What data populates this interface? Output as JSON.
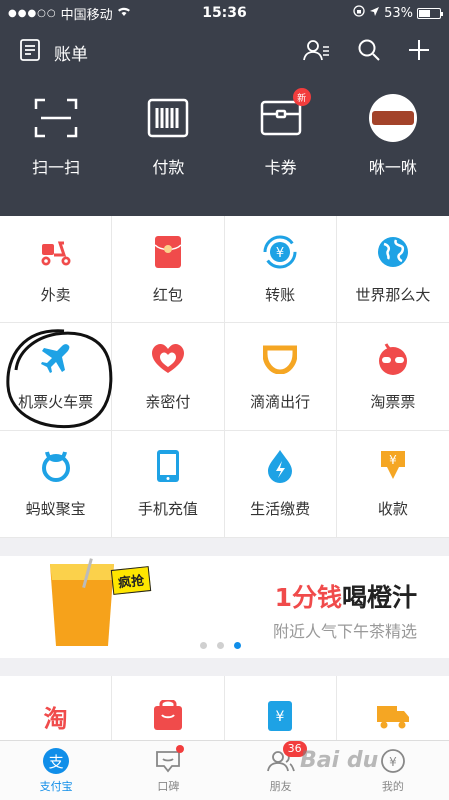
{
  "status_bar": {
    "carrier": "中国移动",
    "time": "15:36",
    "battery": "53%",
    "battery_level": 0.53
  },
  "navbar": {
    "title": "账单"
  },
  "quick_actions": [
    {
      "label": "扫一扫",
      "icon": "scan-icon"
    },
    {
      "label": "付款",
      "icon": "barcode-pay-icon"
    },
    {
      "label": "卡券",
      "icon": "wallet-card-icon",
      "badge": "新"
    },
    {
      "label": "咻一咻",
      "icon": "xiu-avatar-icon"
    }
  ],
  "services": [
    {
      "label": "外卖",
      "icon": "scooter-icon",
      "color": "#f04b4b"
    },
    {
      "label": "红包",
      "icon": "red-envelope-icon",
      "color": "#f04b4b"
    },
    {
      "label": "转账",
      "icon": "transfer-yen-icon",
      "color": "#1ea2e5"
    },
    {
      "label": "世界那么大",
      "icon": "globe-icon",
      "color": "#1ea2e5"
    },
    {
      "label": "机票火车票",
      "icon": "airplane-icon",
      "color": "#1ea2e5"
    },
    {
      "label": "亲密付",
      "icon": "hearts-icon",
      "color": "#f04b4b"
    },
    {
      "label": "滴滴出行",
      "icon": "didi-icon",
      "color": "#f5a623"
    },
    {
      "label": "淘票票",
      "icon": "taopiaopiao-icon",
      "color": "#f04b4b"
    },
    {
      "label": "蚂蚁聚宝",
      "icon": "ant-treasure-icon",
      "color": "#1ea2e5"
    },
    {
      "label": "手机充值",
      "icon": "phone-icon",
      "color": "#1ea2e5"
    },
    {
      "label": "生活缴费",
      "icon": "water-drop-icon",
      "color": "#1ea2e5"
    },
    {
      "label": "收款",
      "icon": "receive-money-icon",
      "color": "#f5a623"
    }
  ],
  "banner": {
    "tag": "疯抢",
    "headline_highlight": "1分钱",
    "headline_rest": "喝橙汁",
    "subtitle": "附近人气下午茶精选",
    "pages": 3,
    "active_page": 3
  },
  "more_services": [
    {
      "icon": "taobao-icon",
      "glyph": "淘",
      "color": "#f04b4b"
    },
    {
      "icon": "tmall-bag-icon",
      "color": "#f04b4b"
    },
    {
      "icon": "yen-book-icon",
      "color": "#1ea2e5"
    },
    {
      "icon": "delivery-truck-icon",
      "color": "#f5a623"
    }
  ],
  "tabs": [
    {
      "label": "支付宝",
      "icon": "alipay-icon",
      "glyph": "支",
      "active": true
    },
    {
      "label": "口碑",
      "icon": "koubei-icon",
      "dot": true
    },
    {
      "label": "朋友",
      "icon": "friends-icon",
      "badge": "36"
    },
    {
      "label": "我的",
      "icon": "profile-icon"
    }
  ],
  "watermark": "Bai du"
}
